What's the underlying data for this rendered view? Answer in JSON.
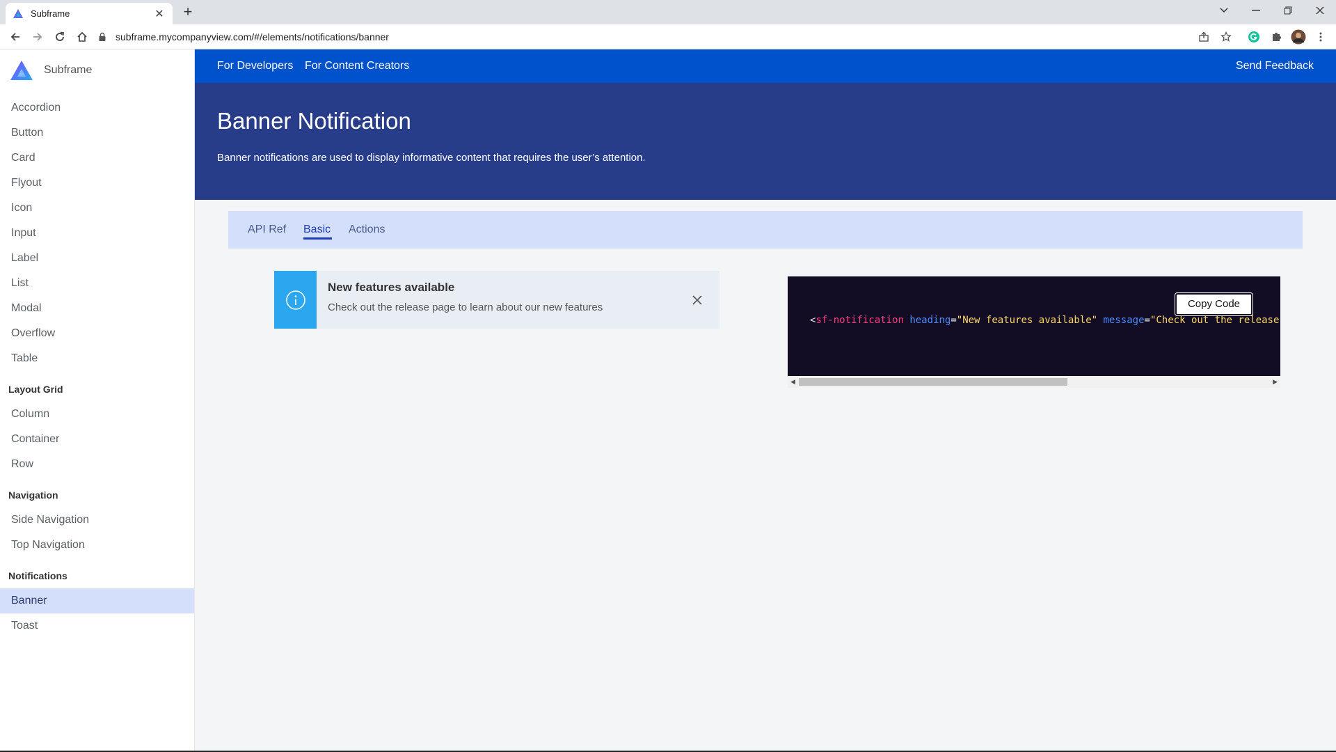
{
  "browser": {
    "tab_title": "Subframe",
    "tab_close": "✕",
    "new_tab": "+",
    "url": "subframe.mycompanyview.com/#/elements/notifications/banner"
  },
  "sidebar": {
    "brand": "Subframe",
    "components": [
      "Accordion",
      "Button",
      "Card",
      "Flyout",
      "Icon",
      "Input",
      "Label",
      "List",
      "Modal",
      "Overflow",
      "Table"
    ],
    "layout_heading": "Layout Grid",
    "layout": [
      "Column",
      "Container",
      "Row"
    ],
    "navigation_heading": "Navigation",
    "navigation": [
      "Side Navigation",
      "Top Navigation"
    ],
    "notifications_heading": "Notifications",
    "notifications": [
      "Banner",
      "Toast"
    ],
    "active_item": "Banner"
  },
  "topnav": {
    "developers": "For Developers",
    "creators": "For Content Creators",
    "feedback": "Send Feedback"
  },
  "hero": {
    "title": "Banner Notification",
    "description": "Banner notifications are used to display informative content that requires the user’s attention."
  },
  "tabs": {
    "items": [
      "API Ref",
      "Basic",
      "Actions"
    ],
    "active": "Basic"
  },
  "banner": {
    "heading": "New features available",
    "message": "Check out the release page to learn about our new features"
  },
  "code": {
    "copy_label": "Copy Code",
    "open": "<",
    "tag": "sf-notification",
    "attr1": "heading",
    "eq": "=",
    "val1": "\"New features available\"",
    "attr2": "message",
    "val2": "\"Check out the release page to learn about our new features\""
  },
  "colors": {
    "topnav": "#0052cc",
    "hero": "#283d8a",
    "accent": "#2aa7ef",
    "active_tab": "#1c3bb5"
  }
}
